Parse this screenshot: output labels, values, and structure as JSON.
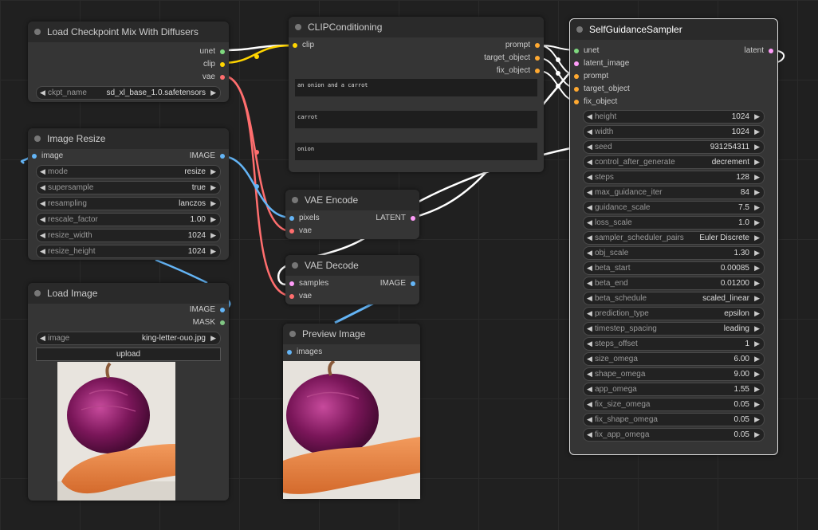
{
  "nodes": {
    "checkpoint": {
      "title": "Load Checkpoint Mix With Diffusers",
      "outputs": [
        "unet",
        "clip",
        "vae"
      ],
      "widget": {
        "label": "ckpt_name",
        "value": "sd_xl_base_1.0.safetensors"
      }
    },
    "resize": {
      "title": "Image Resize",
      "input": "image",
      "output": "IMAGE",
      "widgets": [
        {
          "label": "mode",
          "value": "resize"
        },
        {
          "label": "supersample",
          "value": "true"
        },
        {
          "label": "resampling",
          "value": "lanczos"
        },
        {
          "label": "rescale_factor",
          "value": "1.00"
        },
        {
          "label": "resize_width",
          "value": "1024"
        },
        {
          "label": "resize_height",
          "value": "1024"
        }
      ]
    },
    "load_image": {
      "title": "Load Image",
      "outputs": [
        "IMAGE",
        "MASK"
      ],
      "widget": {
        "label": "image",
        "value": "king-letter-ouo.jpg"
      },
      "button": "upload"
    },
    "clip": {
      "title": "CLIPConditioning",
      "input": "clip",
      "outputs": [
        "prompt",
        "target_object",
        "fix_object"
      ],
      "texts": [
        "an onion and a carrot",
        "carrot",
        "onion"
      ]
    },
    "vae_encode": {
      "title": "VAE Encode",
      "inputs": [
        "pixels",
        "vae"
      ],
      "output": "LATENT"
    },
    "vae_decode": {
      "title": "VAE Decode",
      "inputs": [
        "samples",
        "vae"
      ],
      "output": "IMAGE"
    },
    "preview": {
      "title": "Preview Image",
      "input": "images"
    },
    "sampler": {
      "title": "SelfGuidanceSampler",
      "inputs": [
        "unet",
        "latent_image",
        "prompt",
        "target_object",
        "fix_object"
      ],
      "output": "latent",
      "widgets": [
        {
          "label": "height",
          "value": "1024"
        },
        {
          "label": "width",
          "value": "1024"
        },
        {
          "label": "seed",
          "value": "931254311"
        },
        {
          "label": "control_after_generate",
          "value": "decrement"
        },
        {
          "label": "steps",
          "value": "128"
        },
        {
          "label": "max_guidance_iter",
          "value": "84"
        },
        {
          "label": "guidance_scale",
          "value": "7.5"
        },
        {
          "label": "loss_scale",
          "value": "1.0"
        },
        {
          "label": "sampler_scheduler_pairs",
          "value": "Euler Discrete"
        },
        {
          "label": "obj_scale",
          "value": "1.30"
        },
        {
          "label": "beta_start",
          "value": "0.00085"
        },
        {
          "label": "beta_end",
          "value": "0.01200"
        },
        {
          "label": "beta_schedule",
          "value": "scaled_linear"
        },
        {
          "label": "prediction_type",
          "value": "epsilon"
        },
        {
          "label": "timestep_spacing",
          "value": "leading"
        },
        {
          "label": "steps_offset",
          "value": "1"
        },
        {
          "label": "size_omega",
          "value": "6.00"
        },
        {
          "label": "shape_omega",
          "value": "9.00"
        },
        {
          "label": "app_omega",
          "value": "1.55"
        },
        {
          "label": "fix_size_omega",
          "value": "0.05"
        },
        {
          "label": "fix_shape_omega",
          "value": "0.05"
        },
        {
          "label": "fix_app_omega",
          "value": "0.05"
        }
      ]
    }
  },
  "colors": {
    "model": "#7fd97f",
    "clip": "#ffd500",
    "vae": "#ff6e6e",
    "image": "#64b5f6",
    "latent": "#ff9cf9",
    "conditioning": "#ffa931",
    "mask": "#81c784",
    "link_white": "#ffffff"
  },
  "icons": {
    "arrow_left": "◀",
    "arrow_right": "▶",
    "node_dot": "collapse-dot-icon"
  }
}
